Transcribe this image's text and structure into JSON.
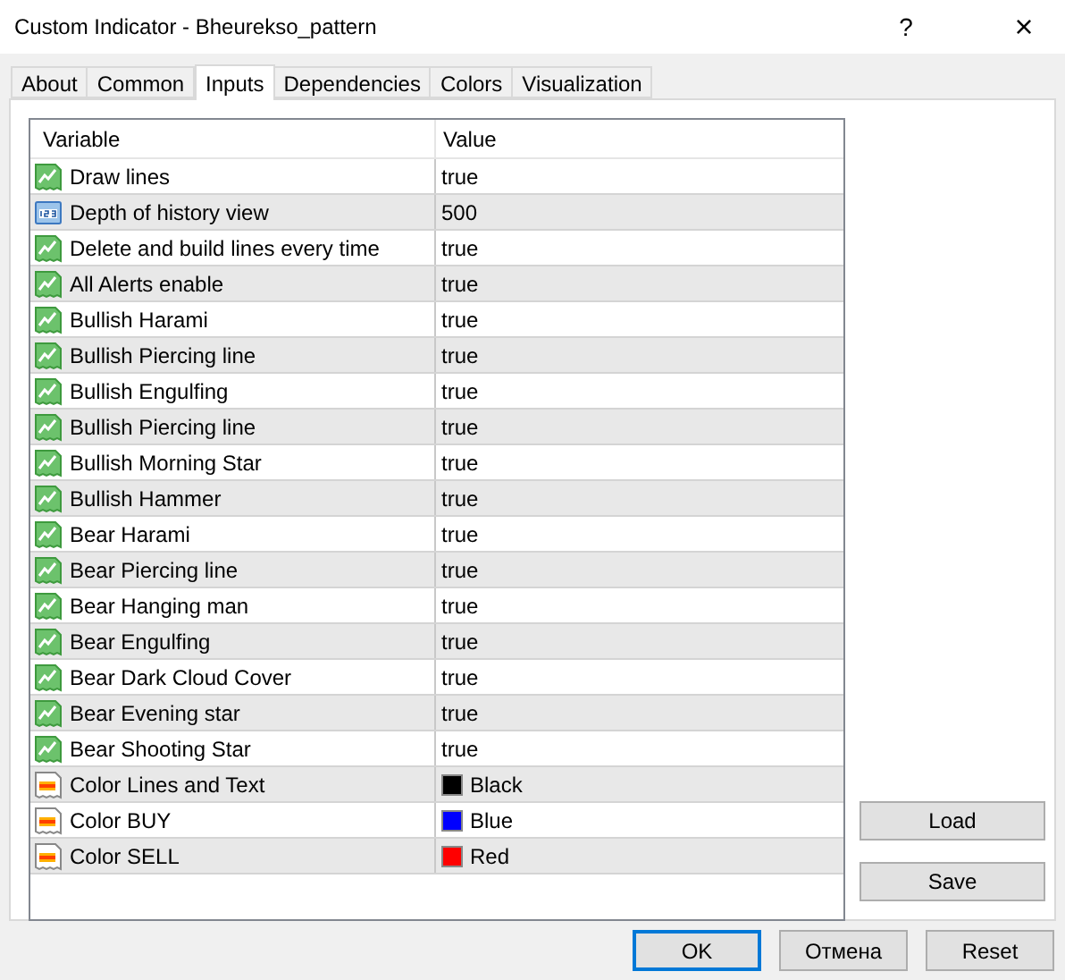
{
  "window": {
    "title": "Custom Indicator - Bheurekso_pattern",
    "help": "?",
    "close": "×"
  },
  "tabs": [
    {
      "label": "About",
      "selected": false
    },
    {
      "label": "Common",
      "selected": false
    },
    {
      "label": "Inputs",
      "selected": true
    },
    {
      "label": "Dependencies",
      "selected": false
    },
    {
      "label": "Colors",
      "selected": false
    },
    {
      "label": "Visualization",
      "selected": false
    }
  ],
  "table": {
    "columns": [
      "Variable",
      "Value"
    ],
    "rows": [
      {
        "kind": "bool",
        "variable": "Draw lines",
        "value": "true"
      },
      {
        "kind": "int",
        "variable": "Depth of history view",
        "value": "500"
      },
      {
        "kind": "bool",
        "variable": "Delete and build lines every time",
        "value": "true"
      },
      {
        "kind": "bool",
        "variable": "All Alerts enable",
        "value": "true"
      },
      {
        "kind": "bool",
        "variable": "Bullish Harami",
        "value": "true"
      },
      {
        "kind": "bool",
        "variable": "Bullish Piercing line",
        "value": "true"
      },
      {
        "kind": "bool",
        "variable": "Bullish Engulfing",
        "value": "true"
      },
      {
        "kind": "bool",
        "variable": "Bullish Piercing line",
        "value": "true"
      },
      {
        "kind": "bool",
        "variable": "Bullish Morning Star",
        "value": "true"
      },
      {
        "kind": "bool",
        "variable": "Bullish Hammer",
        "value": "true"
      },
      {
        "kind": "bool",
        "variable": "Bear Harami",
        "value": "true"
      },
      {
        "kind": "bool",
        "variable": "Bear Piercing line",
        "value": "true"
      },
      {
        "kind": "bool",
        "variable": "Bear Hanging man",
        "value": "true"
      },
      {
        "kind": "bool",
        "variable": "Bear Engulfing",
        "value": "true"
      },
      {
        "kind": "bool",
        "variable": "Bear Dark Cloud Cover",
        "value": "true"
      },
      {
        "kind": "bool",
        "variable": "Bear Evening star",
        "value": "true"
      },
      {
        "kind": "bool",
        "variable": "Bear Shooting Star",
        "value": "true"
      },
      {
        "kind": "color",
        "variable": "Color Lines and Text",
        "value": "Black",
        "color": "#000000"
      },
      {
        "kind": "color",
        "variable": "Color BUY",
        "value": "Blue",
        "color": "#0000ff"
      },
      {
        "kind": "color",
        "variable": "Color SELL",
        "value": "Red",
        "color": "#ff0000"
      }
    ]
  },
  "side_buttons": [
    "Load",
    "Save"
  ],
  "footer_buttons": [
    {
      "label": "OK",
      "default": true
    },
    {
      "label": "Отмена",
      "default": false
    },
    {
      "label": "Reset",
      "default": false
    }
  ]
}
